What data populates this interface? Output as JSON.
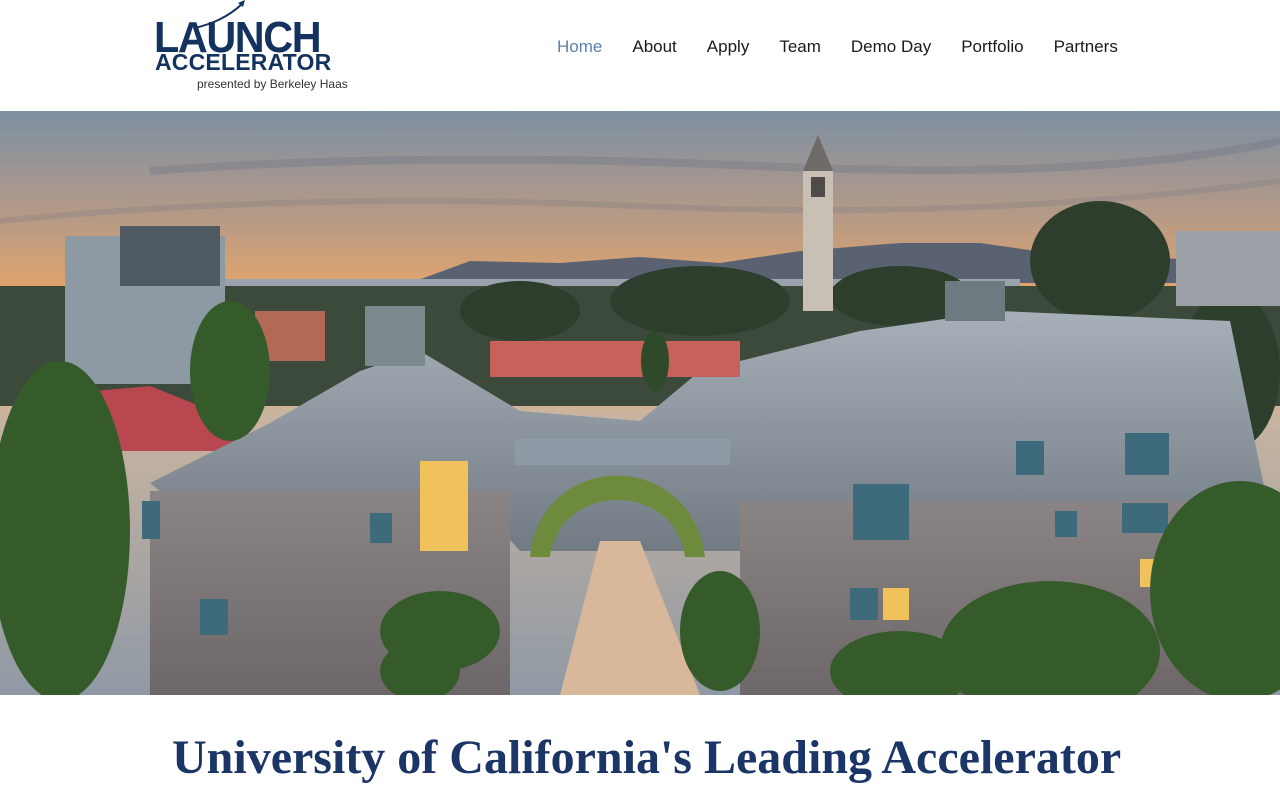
{
  "logo": {
    "main": "LAUNCH",
    "sub": "ACCELERATOR",
    "credit": "presented by Berkeley Haas"
  },
  "nav": {
    "items": [
      {
        "label": "Home",
        "active": true
      },
      {
        "label": "About",
        "active": false
      },
      {
        "label": "Apply",
        "active": false
      },
      {
        "label": "Team",
        "active": false
      },
      {
        "label": "Demo Day",
        "active": false
      },
      {
        "label": "Portfolio",
        "active": false
      },
      {
        "label": "Partners",
        "active": false
      }
    ]
  },
  "hero": {
    "image": "aerial-photo-berkeley-haas-campus-at-sunset"
  },
  "headline": {
    "text": "University of California's Leading Accelerator"
  },
  "colors": {
    "brand": "#13325e",
    "nav_active": "#5a82a8",
    "headline": "#1b3566"
  }
}
